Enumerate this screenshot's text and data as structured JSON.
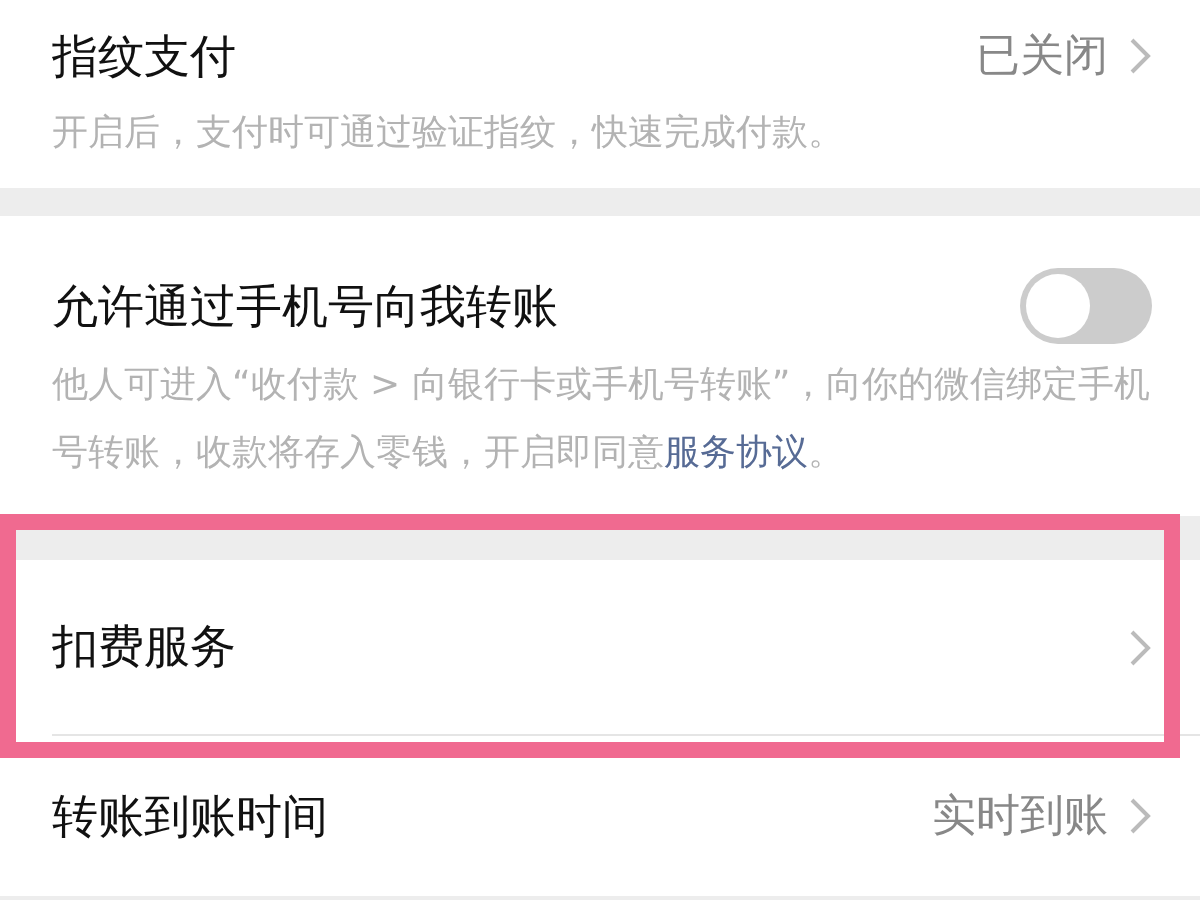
{
  "sections": [
    {
      "items": [
        {
          "kind": "link",
          "title": "指纹支付",
          "value": "已关闭",
          "highlighted": false,
          "description": {
            "text": "开启后，支付时可通过验证指纹，快速完成付款。"
          }
        }
      ]
    },
    {
      "items": [
        {
          "kind": "toggle",
          "title": "允许通过手机号向我转账",
          "on": false,
          "highlighted": false,
          "description": {
            "text": "他人可进入“收付款 > 向银行卡或手机号转账”，向你的微信绑定手机号转账，收款将存入零钱，开启即同意",
            "link": "服务协议",
            "end": "。"
          }
        }
      ]
    },
    {
      "items": [
        {
          "kind": "link",
          "title": "扣费服务",
          "highlighted": true
        },
        {
          "kind": "link",
          "title": "转账到账时间",
          "value": "实时到账",
          "highlighted": false
        }
      ]
    }
  ]
}
